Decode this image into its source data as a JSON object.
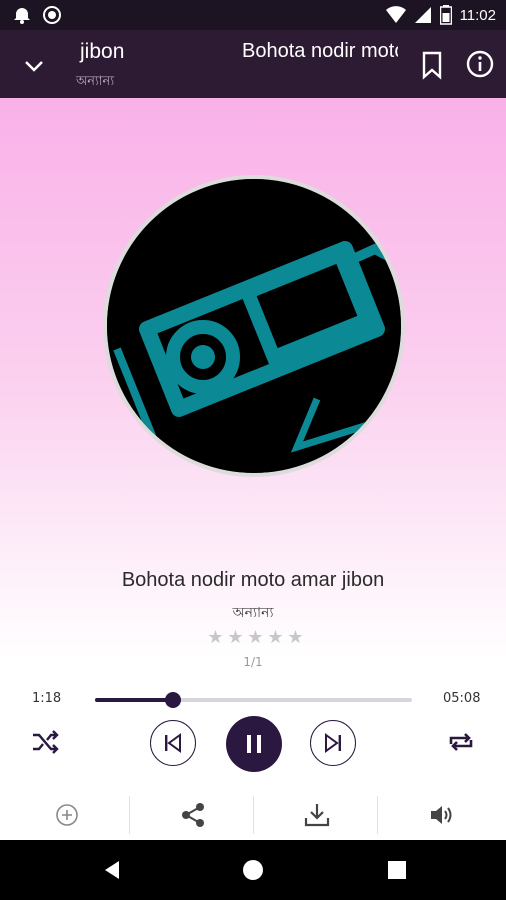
{
  "status_bar": {
    "time": "11:02"
  },
  "app_bar": {
    "playlist_title": "jibon",
    "playlist_subtitle": "অন্যান্য",
    "marquee_title": "Bohota nodir moto amar jibon"
  },
  "track": {
    "title": "Bohota nodir moto amar jibon",
    "subtitle": "অন্যান্য",
    "stars": [
      "★",
      "★",
      "★",
      "★",
      "★"
    ],
    "rating": 0,
    "position_label": "1/1"
  },
  "progress": {
    "current": "1:18",
    "total": "05:08",
    "fraction": 0.245
  },
  "colors": {
    "accent": "#2a1840",
    "app_bar": "#2d1b33",
    "gradient_top": "#f9b1e8",
    "artwork_teal": "#0b8a96"
  },
  "icons": {
    "shuffle": "shuffle-icon",
    "previous": "skip-previous-icon",
    "play_pause": "pause-icon",
    "next": "skip-next-icon",
    "repeat": "repeat-icon",
    "add": "add-circle-icon",
    "share": "share-icon",
    "download": "download-icon",
    "volume": "volume-icon"
  }
}
